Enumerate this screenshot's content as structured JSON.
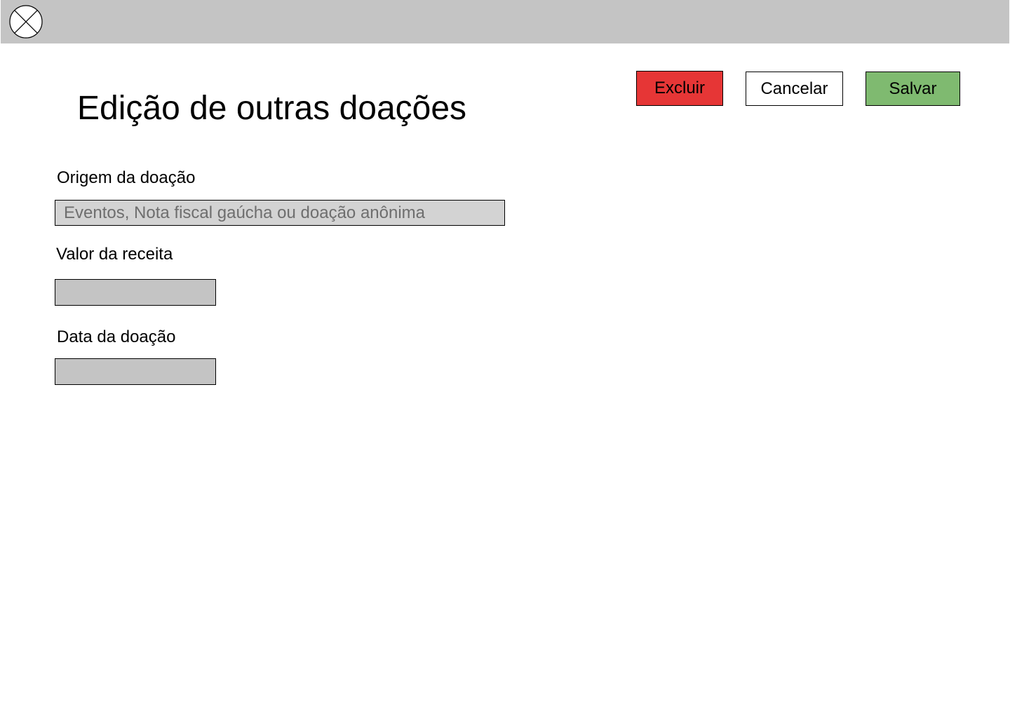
{
  "header": {
    "logo_icon": "circle-x-icon",
    "background_color": "#c4c4c4"
  },
  "page": {
    "title": "Edição de outras doações"
  },
  "actions": {
    "delete_label": "Excluir",
    "delete_color": "#e63636",
    "cancel_label": "Cancelar",
    "save_label": "Salvar",
    "save_color": "#7fba70"
  },
  "form": {
    "origin": {
      "label": "Origem da doação",
      "placeholder": "Eventos, Nota fiscal gaúcha ou doação anônima",
      "value": ""
    },
    "amount": {
      "label": "Valor da receita",
      "value": ""
    },
    "date": {
      "label": "Data da doação",
      "value": ""
    }
  }
}
